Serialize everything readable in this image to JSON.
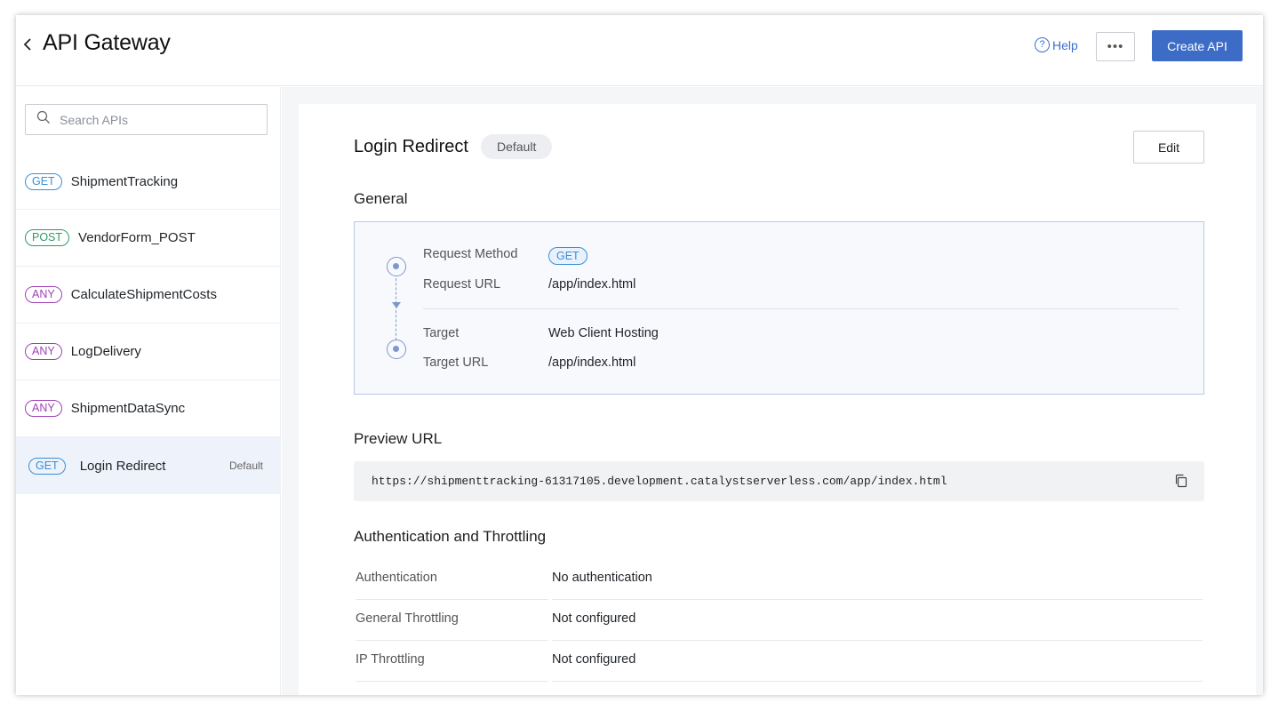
{
  "header": {
    "title": "API Gateway",
    "back_icon": "chevron-left-icon",
    "help_label": "Help",
    "more_label": "•••",
    "create_label": "Create API"
  },
  "sidebar": {
    "search_placeholder": "Search APIs",
    "items": [
      {
        "method": "GET",
        "name": "ShipmentTracking",
        "badge": ""
      },
      {
        "method": "POST",
        "name": "VendorForm_POST",
        "badge": ""
      },
      {
        "method": "ANY",
        "name": "CalculateShipmentCosts",
        "badge": ""
      },
      {
        "method": "ANY",
        "name": "LogDelivery",
        "badge": ""
      },
      {
        "method": "ANY",
        "name": "ShipmentDataSync",
        "badge": ""
      },
      {
        "method": "GET",
        "name": "Login Redirect",
        "badge": "Default"
      }
    ]
  },
  "detail": {
    "title": "Login Redirect",
    "default_pill": "Default",
    "edit_label": "Edit",
    "general": {
      "section_title": "General",
      "request_method_label": "Request Method",
      "request_method_value": "GET",
      "request_url_label": "Request URL",
      "request_url_value": "/app/index.html",
      "target_label": "Target",
      "target_value": "Web Client Hosting",
      "target_url_label": "Target URL",
      "target_url_value": "/app/index.html"
    },
    "preview": {
      "section_title": "Preview URL",
      "url": "https://shipmenttracking-61317105.development.catalystserverless.com/app/index.html"
    },
    "auth": {
      "section_title": "Authentication and Throttling",
      "rows": [
        {
          "label": "Authentication",
          "value": "No authentication"
        },
        {
          "label": "General Throttling",
          "value": "Not configured"
        },
        {
          "label": "IP Throttling",
          "value": "Not configured"
        }
      ]
    }
  },
  "colors": {
    "accent": "#3d6cc7",
    "get": "#3a8fd6",
    "post": "#2f9a62",
    "any": "#a13fb8"
  }
}
